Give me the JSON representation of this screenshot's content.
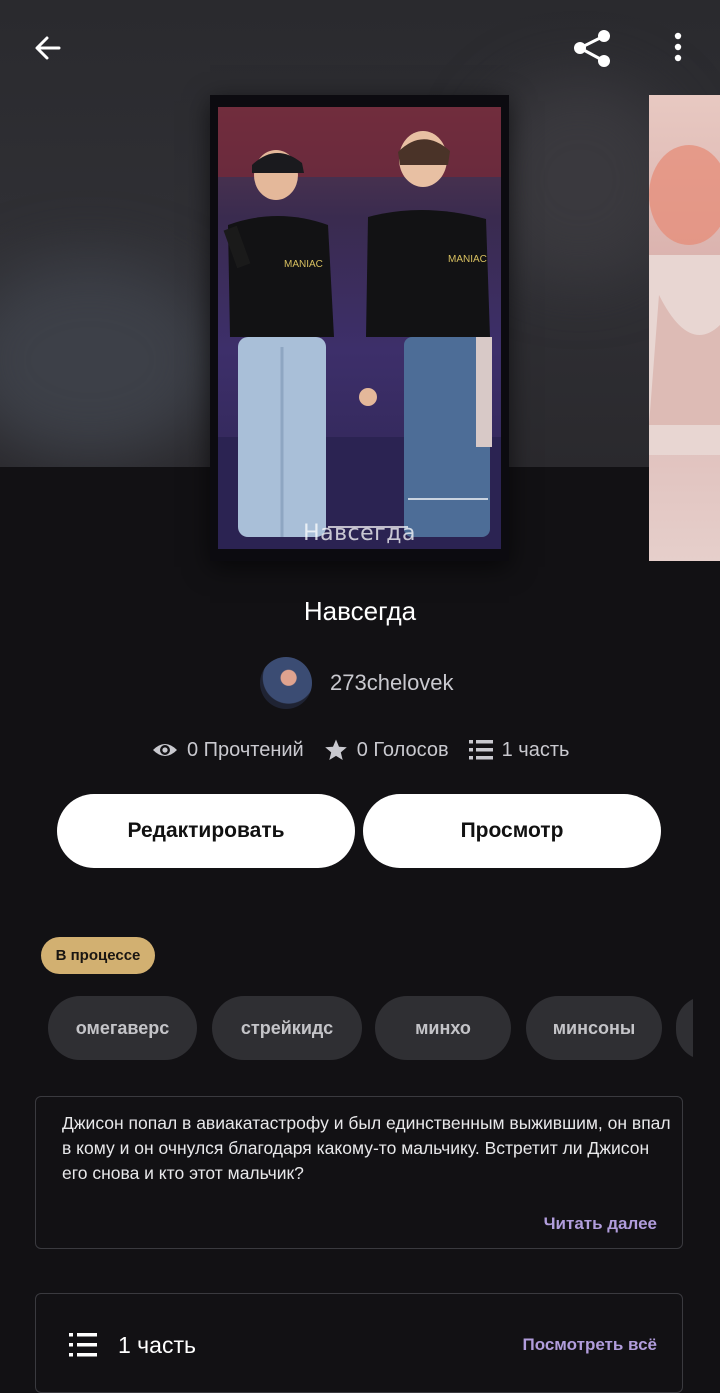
{
  "header": {
    "back_icon": "arrow-left-icon",
    "share_icon": "share-icon",
    "menu_icon": "more-vertical-icon"
  },
  "cover": {
    "caption": "Навсегда"
  },
  "story": {
    "title": "Навсегда",
    "author": "273chelovek"
  },
  "stats": {
    "reads": "0 Прочтений",
    "votes": "0 Голосов",
    "parts": "1 часть"
  },
  "actions": {
    "edit_label": "Редактировать",
    "preview_label": "Просмотр"
  },
  "status": {
    "label": "В процессе",
    "color": "#d2b071"
  },
  "tags": [
    "омегаверс",
    "стрейкидс",
    "минхо",
    "минсоны"
  ],
  "description": {
    "text": "Джисон попал в авиакатастрофу и был единственным выжившим, он впал в кому и он очнулся благодаря какому-то мальчику. Встретит ли Джисон его снова и кто этот мальчик?",
    "read_more": "Читать далее"
  },
  "parts_section": {
    "label": "1 часть",
    "see_all": "Посмотреть всё"
  },
  "colors": {
    "background": "#121114",
    "accent": "#b19ddc",
    "chip": "#2f2f33"
  }
}
